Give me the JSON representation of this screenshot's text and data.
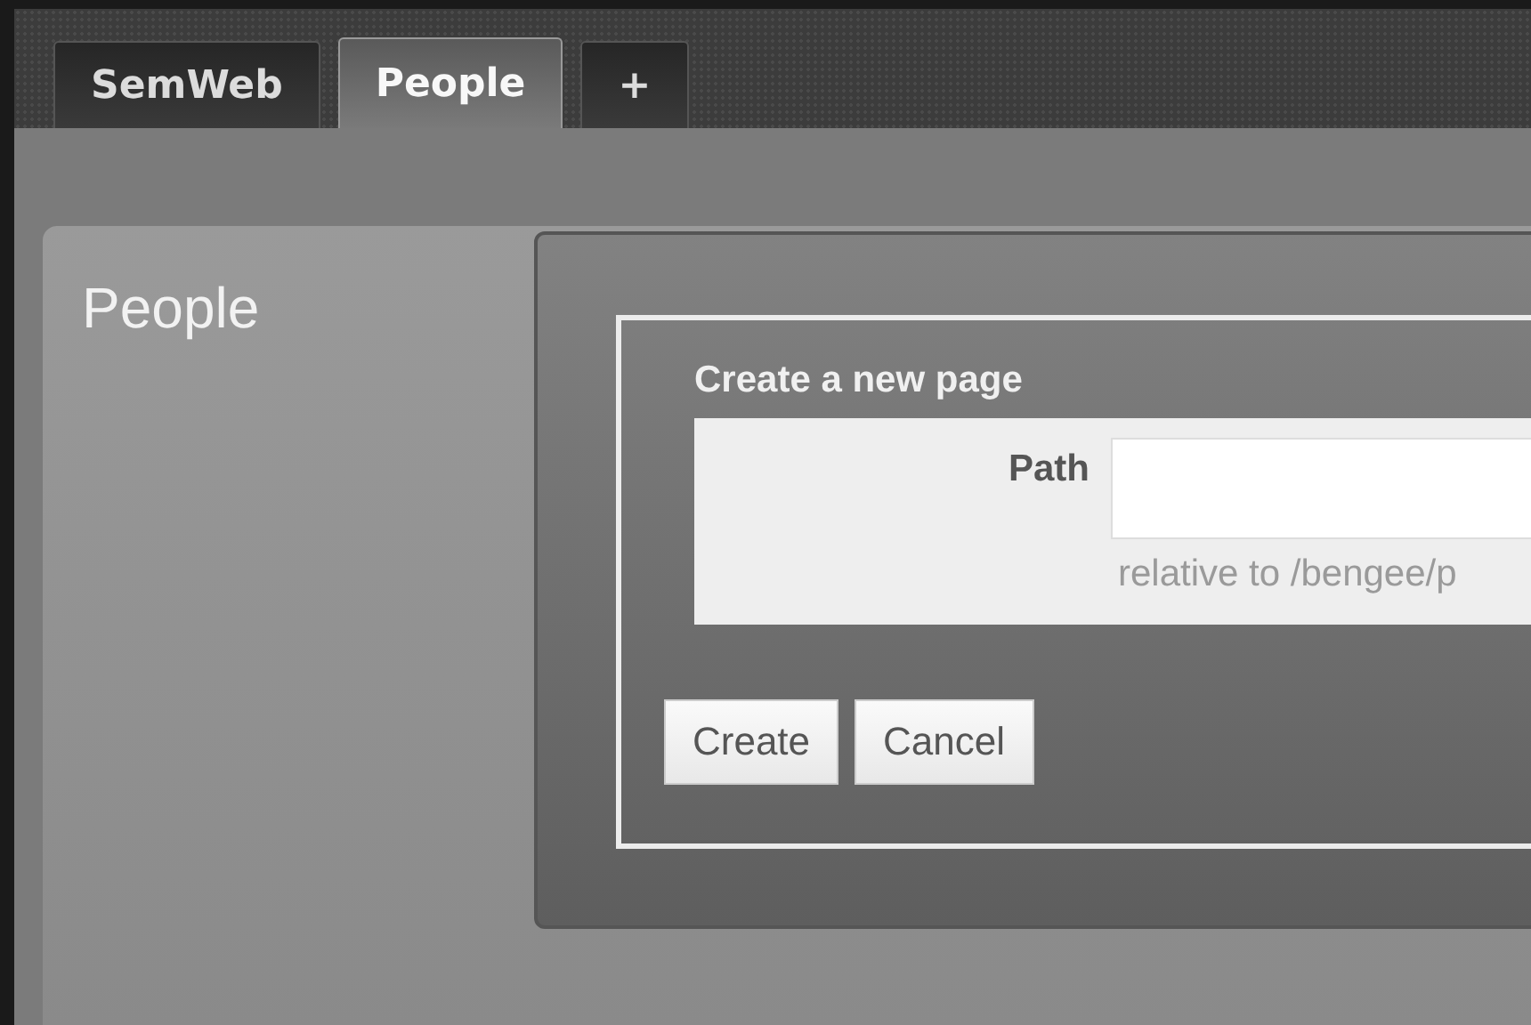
{
  "tabs": [
    {
      "label": "SemWeb",
      "selected": false
    },
    {
      "label": "People",
      "selected": true
    },
    {
      "label": "+",
      "selected": false
    }
  ],
  "sidebar": {
    "title": "People"
  },
  "dialog": {
    "title": "Create a new page",
    "field": {
      "label": "Path",
      "hint": "relative to /bengee/p"
    },
    "buttons": [
      "Create",
      "Cancel"
    ]
  }
}
